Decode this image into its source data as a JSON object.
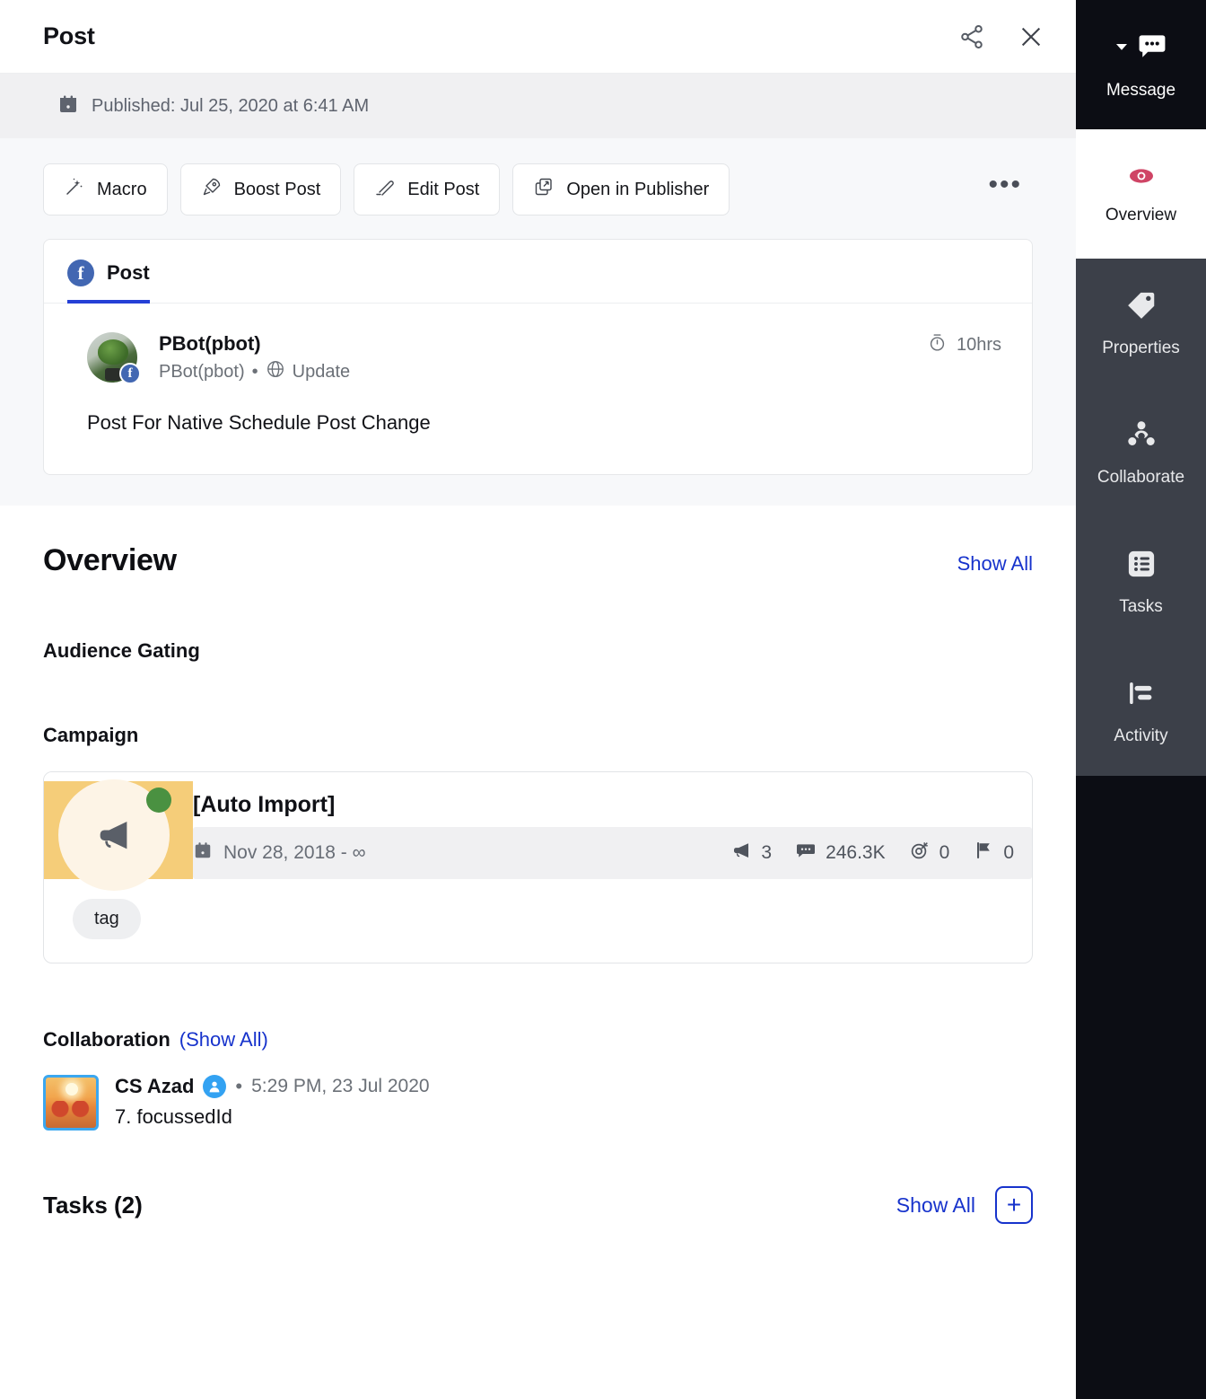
{
  "header": {
    "title": "Post",
    "share_icon": "share-icon",
    "close_icon": "close-icon"
  },
  "publish": {
    "calendar_icon": "calendar-icon",
    "text": "Published: Jul 25, 2020 at 6:41 AM"
  },
  "toolbar": {
    "buttons": [
      {
        "label": "Macro",
        "icon": "magic-wand-icon"
      },
      {
        "label": "Boost Post",
        "icon": "rocket-icon"
      },
      {
        "label": "Edit Post",
        "icon": "pencil-icon"
      },
      {
        "label": "Open in Publisher",
        "icon": "external-window-icon"
      }
    ],
    "more_label": "•••"
  },
  "post_card": {
    "tab_label": "Post",
    "network_icon": "facebook-icon",
    "author_name": "PBot(pbot)",
    "author_handle": "PBot(pbot)",
    "separator": "•",
    "post_type": "Update",
    "globe_icon": "globe-icon",
    "timer_icon": "timer-icon",
    "time_ago": "10hrs",
    "body": "Post For Native Schedule Post Change"
  },
  "overview": {
    "title": "Overview",
    "show_all": "Show All",
    "audience_gating_label": "Audience Gating",
    "campaign_label": "Campaign"
  },
  "campaign": {
    "name": "[Auto Import]",
    "calendar_icon": "calendar-icon",
    "dates": "Nov 28, 2018 - ∞",
    "metrics": [
      {
        "icon": "megaphone-icon",
        "value": "3"
      },
      {
        "icon": "comment-icon",
        "value": "246.3K"
      },
      {
        "icon": "target-icon",
        "value": "0"
      },
      {
        "icon": "flag-icon",
        "value": "0"
      }
    ],
    "tag": "tag",
    "thumb_icon": "megaphone-icon",
    "status_color": "#4a9141",
    "thumb_bg": "#f5cd79"
  },
  "collaboration": {
    "title": "Collaboration",
    "show_all": "(Show All)",
    "entries": [
      {
        "name": "CS Azad",
        "user_icon": "user-badge-icon",
        "separator": "•",
        "timestamp": "5:29 PM, 23 Jul 2020",
        "message": "7. focussedId"
      }
    ]
  },
  "tasks": {
    "title": "Tasks (2)",
    "show_all": "Show All",
    "add_label": "+"
  },
  "sidebar": {
    "items": [
      {
        "label": "Message",
        "icon": "message-bubble-icon",
        "state": "active-dark",
        "has_caret": true
      },
      {
        "label": "Overview",
        "icon": "eye-icon",
        "state": "selected",
        "has_caret": false
      },
      {
        "label": "Properties",
        "icon": "tag-icon",
        "state": "dark",
        "has_caret": false
      },
      {
        "label": "Collaborate",
        "icon": "people-icon",
        "state": "dark",
        "has_caret": false
      },
      {
        "label": "Tasks",
        "icon": "list-icon",
        "state": "dark",
        "has_caret": false
      },
      {
        "label": "Activity",
        "icon": "activity-icon",
        "state": "dark",
        "has_caret": false
      }
    ]
  },
  "colors": {
    "accent_blue": "#1733cc",
    "facebook_blue": "#4267b2",
    "eye_red": "#cf4465",
    "sidebar_dark": "#3c4049",
    "sidebar_black": "#0c0d14"
  }
}
